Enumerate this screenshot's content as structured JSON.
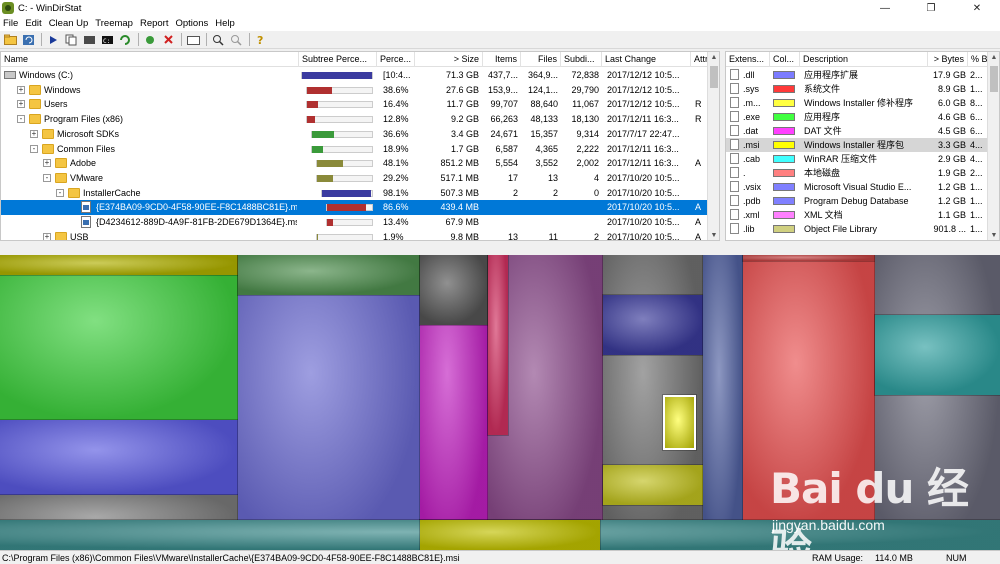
{
  "window": {
    "title": "C: - WinDirStat",
    "controls": {
      "minimize": "—",
      "maximize": "❐",
      "close": "✕"
    }
  },
  "menu": [
    "File",
    "Edit",
    "Clean Up",
    "Treemap",
    "Report",
    "Options",
    "Help"
  ],
  "toolbar": {
    "icons": [
      "open-folder-icon",
      "refresh-icon",
      "play-icon",
      "copy-icon",
      "cut-icon",
      "terminal-icon",
      "refresh-selected-icon",
      "recycle-icon",
      "delete-icon",
      "new-folder-icon",
      "zoom-in-icon",
      "zoom-out-icon",
      "help-icon"
    ]
  },
  "tree": {
    "columns": [
      "Name",
      "Subtree Perce...",
      "Perce...",
      "> Size",
      "Items",
      "Files",
      "Subdi...",
      "Last Change",
      "Attr"
    ],
    "rows": [
      {
        "name": "Windows (C:)",
        "percent": "[10:4...",
        "size": "71.3 GB",
        "items": "437,7...",
        "files": "364,9...",
        "subdirs": "72,838",
        "last_change": "2017/12/12  10:5...",
        "attr": "",
        "fraction": 1.0,
        "bar_color": "#3b3ba0",
        "level": 0,
        "expander": "-",
        "icon": "drive",
        "selected": false
      },
      {
        "name": "Windows",
        "percent": "38.6%",
        "size": "27.6 GB",
        "items": "153,9...",
        "files": "124,1...",
        "subdirs": "29,790",
        "last_change": "2017/12/12  10:5...",
        "attr": "",
        "fraction": 0.386,
        "bar_color": "#b03030",
        "level": 1,
        "expander": "+",
        "icon": "folder",
        "selected": false
      },
      {
        "name": "Users",
        "percent": "16.4%",
        "size": "11.7 GB",
        "items": "99,707",
        "files": "88,640",
        "subdirs": "11,067",
        "last_change": "2017/12/12  10:5...",
        "attr": "R",
        "fraction": 0.164,
        "bar_color": "#b03030",
        "level": 1,
        "expander": "+",
        "icon": "folder",
        "selected": false
      },
      {
        "name": "Program Files (x86)",
        "percent": "12.8%",
        "size": "9.2 GB",
        "items": "66,263",
        "files": "48,133",
        "subdirs": "18,130",
        "last_change": "2017/12/11  16:3...",
        "attr": "R",
        "fraction": 0.128,
        "bar_color": "#b03030",
        "level": 1,
        "expander": "-",
        "icon": "folder",
        "selected": false
      },
      {
        "name": "Microsoft SDKs",
        "percent": "36.6%",
        "size": "3.4 GB",
        "items": "24,671",
        "files": "15,357",
        "subdirs": "9,314",
        "last_change": "2017/7/17  22:47...",
        "attr": "",
        "fraction": 0.366,
        "bar_color": "#3a9a3a",
        "level": 2,
        "expander": "+",
        "icon": "folder",
        "selected": false
      },
      {
        "name": "Common Files",
        "percent": "18.9%",
        "size": "1.7 GB",
        "items": "6,587",
        "files": "4,365",
        "subdirs": "2,222",
        "last_change": "2017/12/11  16:3...",
        "attr": "",
        "fraction": 0.189,
        "bar_color": "#3a9a3a",
        "level": 2,
        "expander": "-",
        "icon": "folder",
        "selected": false
      },
      {
        "name": "Adobe",
        "percent": "48.1%",
        "size": "851.2 MB",
        "items": "5,554",
        "files": "3,552",
        "subdirs": "2,002",
        "last_change": "2017/12/11  16:3...",
        "attr": "A",
        "fraction": 0.481,
        "bar_color": "#8a8a3a",
        "level": 3,
        "expander": "+",
        "icon": "folder",
        "selected": false
      },
      {
        "name": "VMware",
        "percent": "29.2%",
        "size": "517.1 MB",
        "items": "17",
        "files": "13",
        "subdirs": "4",
        "last_change": "2017/10/20  10:5...",
        "attr": "",
        "fraction": 0.292,
        "bar_color": "#8a8a3a",
        "level": 3,
        "expander": "-",
        "icon": "folder",
        "selected": false
      },
      {
        "name": "InstallerCache",
        "percent": "98.1%",
        "size": "507.3 MB",
        "items": "2",
        "files": "2",
        "subdirs": "0",
        "last_change": "2017/10/20  10:5...",
        "attr": "",
        "fraction": 0.981,
        "bar_color": "#3b3ba0",
        "level": 4,
        "expander": "-",
        "icon": "folder",
        "selected": false
      },
      {
        "name": "{E374BA09-9CD0-4F58-90EE-F8C1488BC81E}.msi",
        "percent": "86.6%",
        "size": "439.4 MB",
        "items": "",
        "files": "",
        "subdirs": "",
        "last_change": "2017/10/20  10:5...",
        "attr": "A",
        "fraction": 0.866,
        "bar_color": "#b03030",
        "level": 5,
        "expander": "",
        "icon": "file",
        "selected": true
      },
      {
        "name": "{D4234612-889D-4A9F-81FB-2DE679D1364E}.msi",
        "percent": "13.4%",
        "size": "67.9 MB",
        "items": "",
        "files": "",
        "subdirs": "",
        "last_change": "2017/10/20  10:5...",
        "attr": "A",
        "fraction": 0.134,
        "bar_color": "#b03030",
        "level": 5,
        "expander": "",
        "icon": "file",
        "selected": false
      },
      {
        "name": "USB",
        "percent": "1.9%",
        "size": "9.8 MB",
        "items": "13",
        "files": "11",
        "subdirs": "2",
        "last_change": "2017/10/20  10:5...",
        "attr": "A",
        "fraction": 0.019,
        "bar_color": "#8a8a3a",
        "level": 3,
        "expander": "+",
        "icon": "folder",
        "selected": false
      }
    ]
  },
  "extensions": {
    "columns": [
      "Extens...",
      "Col...",
      "Description",
      "> Bytes",
      "% B..."
    ],
    "rows": [
      {
        "ext": ".dll",
        "color": "#7b7bff",
        "description": "应用程序扩展",
        "bytes": "17.9 GB",
        "pct": "2...",
        "highlight": false
      },
      {
        "ext": ".sys",
        "color": "#ff3a3a",
        "description": "系统文件",
        "bytes": "8.9 GB",
        "pct": "1...",
        "highlight": false
      },
      {
        "ext": ".m...",
        "color": "#ffff40",
        "description": "Windows Installer 修补程序",
        "bytes": "6.0 GB",
        "pct": "8...",
        "highlight": false
      },
      {
        "ext": ".exe",
        "color": "#40ff40",
        "description": "应用程序",
        "bytes": "4.6 GB",
        "pct": "6...",
        "highlight": false
      },
      {
        "ext": ".dat",
        "color": "#ff40ff",
        "description": "DAT 文件",
        "bytes": "4.5 GB",
        "pct": "6...",
        "highlight": false
      },
      {
        "ext": ".msi",
        "color": "#ffff00",
        "description": "Windows Installer 程序包",
        "bytes": "3.3 GB",
        "pct": "4...",
        "highlight": true
      },
      {
        "ext": ".cab",
        "color": "#40ffff",
        "description": "WinRAR 压缩文件",
        "bytes": "2.9 GB",
        "pct": "4...",
        "highlight": false
      },
      {
        "ext": ".",
        "color": "#ff8080",
        "description": "本地磁盘",
        "bytes": "1.9 GB",
        "pct": "2...",
        "highlight": false
      },
      {
        "ext": ".vsix",
        "color": "#8080ff",
        "description": "Microsoft Visual Studio E...",
        "bytes": "1.2 GB",
        "pct": "1...",
        "highlight": false
      },
      {
        "ext": ".pdb",
        "color": "#8080ff",
        "description": "Program Debug Database",
        "bytes": "1.2 GB",
        "pct": "1...",
        "highlight": false
      },
      {
        "ext": ".xml",
        "color": "#ff80ff",
        "description": "XML 文档",
        "bytes": "1.1 GB",
        "pct": "1...",
        "highlight": false
      },
      {
        "ext": ".lib",
        "color": "#d0d080",
        "description": "Object File Library",
        "bytes": "901.8 ...",
        "pct": "1...",
        "highlight": false
      }
    ]
  },
  "status": {
    "path": "C:\\Program Files (x86)\\Common Files\\VMware\\InstallerCache\\{E374BA09-9CD0-4F58-90EE-F8C1488BC81E}.msi",
    "ram_label": "RAM Usage:",
    "ram_value": "114.0 MB",
    "num": "NUM"
  },
  "watermark": {
    "logo": "Bai du 经验",
    "url": "jingyan.baidu.com"
  }
}
